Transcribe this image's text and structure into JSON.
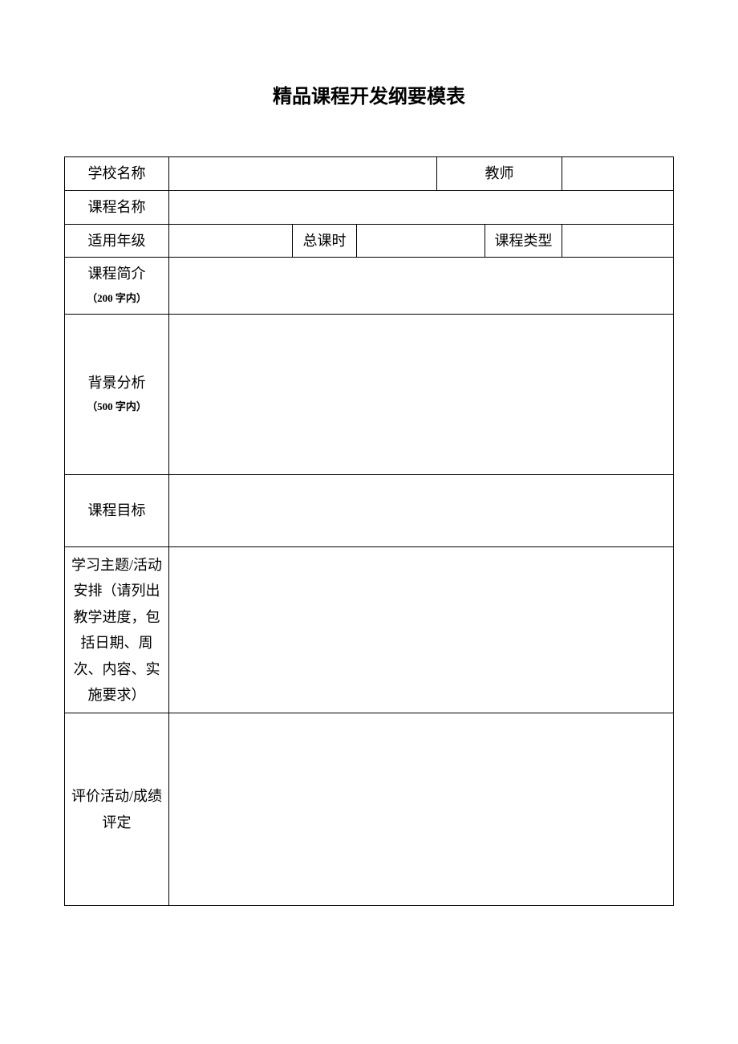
{
  "title": "精品课程开发纲要模表",
  "labels": {
    "schoolName": "学校名称",
    "teacher": "教师",
    "courseName": "课程名称",
    "gradeLevel": "适用年级",
    "totalHours": "总课时",
    "courseType": "课程类型",
    "courseIntro": "课程简介",
    "courseIntroSub": "（200 字内）",
    "background": "背景分析",
    "backgroundSub": "（500 字内）",
    "courseGoal": "课程目标",
    "studyTopic": "学习主题/活动安排（请列出教学进度，包括日期、周次、内容、实施要求）",
    "evaluation": "评价活动/成绩评定"
  },
  "values": {
    "schoolName": "",
    "teacher": "",
    "courseName": "",
    "gradeLevel": "",
    "totalHours": "",
    "courseType": "",
    "courseIntro": "",
    "background": "",
    "courseGoal": "",
    "studyTopic": "",
    "evaluation": ""
  }
}
